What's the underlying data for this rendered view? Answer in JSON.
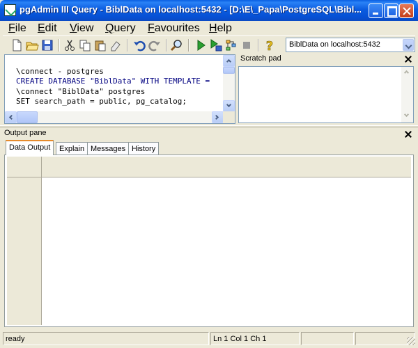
{
  "window": {
    "title": "pgAdmin III Query - BiblData on localhost:5432 - [D:\\E\\_Papa\\PostgreSQL\\Bibl..."
  },
  "menu": [
    "File",
    "Edit",
    "View",
    "Query",
    "Favourites",
    "Help"
  ],
  "toolbar": {
    "connection": "BiblData on localhost:5432",
    "icons": [
      "new-file-icon",
      "open-folder-icon",
      "save-icon",
      "cut-icon",
      "copy-icon",
      "paste-icon",
      "clear-icon",
      "undo-icon",
      "redo-icon",
      "find-icon",
      "execute-icon",
      "execute-to-file-icon",
      "explain-icon",
      "cancel-icon",
      "help-icon"
    ]
  },
  "editor": {
    "lines": [
      "\\connect - postgres",
      "CREATE DATABASE \"BiblData\" WITH TEMPLATE = ",
      "\\connect \"BiblData\" postgres",
      "SET search_path = public, pg_catalog;",
      "--"
    ]
  },
  "scratch_pad": {
    "title": "Scratch pad"
  },
  "output": {
    "title": "Output pane",
    "tabs": [
      "Data Output",
      "Explain",
      "Messages",
      "History"
    ],
    "active_tab": "Data Output"
  },
  "status": {
    "message": "ready",
    "position": "Ln 1 Col 1 Ch 1"
  },
  "colors": {
    "titlebar": "#0a5fe2",
    "chrome": "#ece9d8",
    "tab_accent": "#e68b2c"
  }
}
